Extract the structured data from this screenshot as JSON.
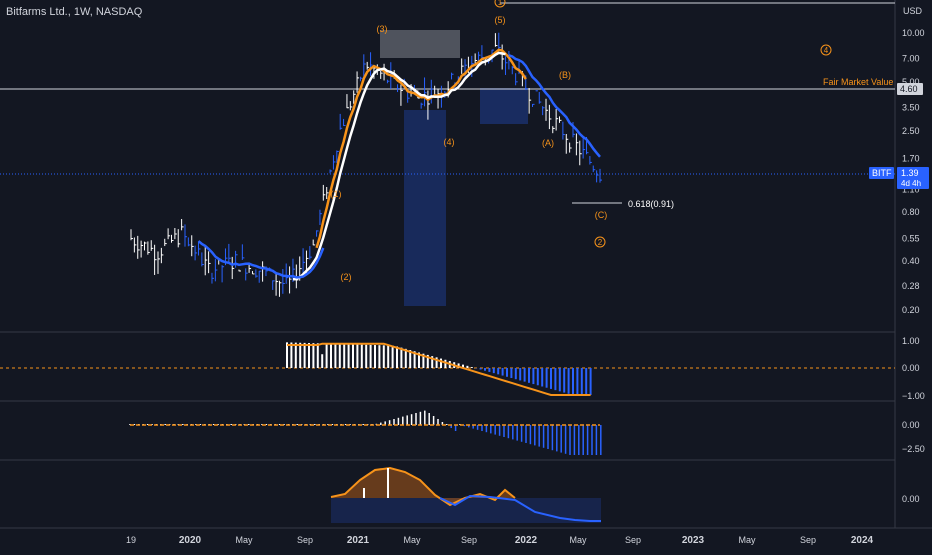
{
  "header": {
    "symbol_line": "Bitfarms Ltd., 1W, NASDAQ"
  },
  "axis": {
    "currency": "USD",
    "price_ticks": [
      "10.00",
      "7.00",
      "5.00",
      "3.50",
      "2.50",
      "1.70",
      "1.10",
      "0.80",
      "0.55",
      "0.40",
      "0.28",
      "0.20"
    ],
    "time_ticks": [
      "19",
      "2020",
      "May",
      "Sep",
      "2021",
      "May",
      "Sep",
      "2022",
      "May",
      "Sep",
      "2023",
      "May",
      "Sep",
      "2024"
    ]
  },
  "levels": {
    "fair_market_label": "Fair Market Value",
    "fair_market_value": "4.60",
    "fib_label": "0.618(0.91)"
  },
  "ticker_badge": {
    "symbol": "BITF",
    "price": "1.39",
    "countdown": "4d 4h"
  },
  "wave_labels": [
    "(1)",
    "(2)",
    "(3)",
    "(4)",
    "(5)",
    "(A)",
    "(B)",
    "(C)",
    "1",
    "2",
    "4"
  ],
  "indicators": {
    "osc1_ticks": [
      "1.00",
      "0.00",
      "−1.00"
    ],
    "osc2_ticks": [
      "0.00",
      "−2.50"
    ],
    "osc3_ticks": [
      "0.00"
    ]
  },
  "colors": {
    "background": "#131722",
    "blue": "#2962ff",
    "orange": "#f7931a",
    "white": "#ffffff",
    "text": "#d1d4dc"
  },
  "chart_data": {
    "type": "line",
    "title": "Bitfarms Ltd., 1W, NASDAQ",
    "y_scale": "log",
    "ylim": [
      0.18,
      13
    ],
    "x": [
      "2019-10",
      "2019-12",
      "2020-02",
      "2020-04",
      "2020-06",
      "2020-08",
      "2020-10",
      "2020-12",
      "2021-01",
      "2021-02",
      "2021-03",
      "2021-05",
      "2021-07",
      "2021-09",
      "2021-11",
      "2022-01",
      "2022-03",
      "2022-05",
      "2022-06"
    ],
    "series": [
      {
        "name": "price",
        "values": [
          0.55,
          0.45,
          0.6,
          0.35,
          0.4,
          0.35,
          0.28,
          0.5,
          2.5,
          6.5,
          5,
          4,
          4.5,
          6.5,
          8,
          5,
          3.2,
          2.1,
          1.39
        ]
      }
    ]
  }
}
